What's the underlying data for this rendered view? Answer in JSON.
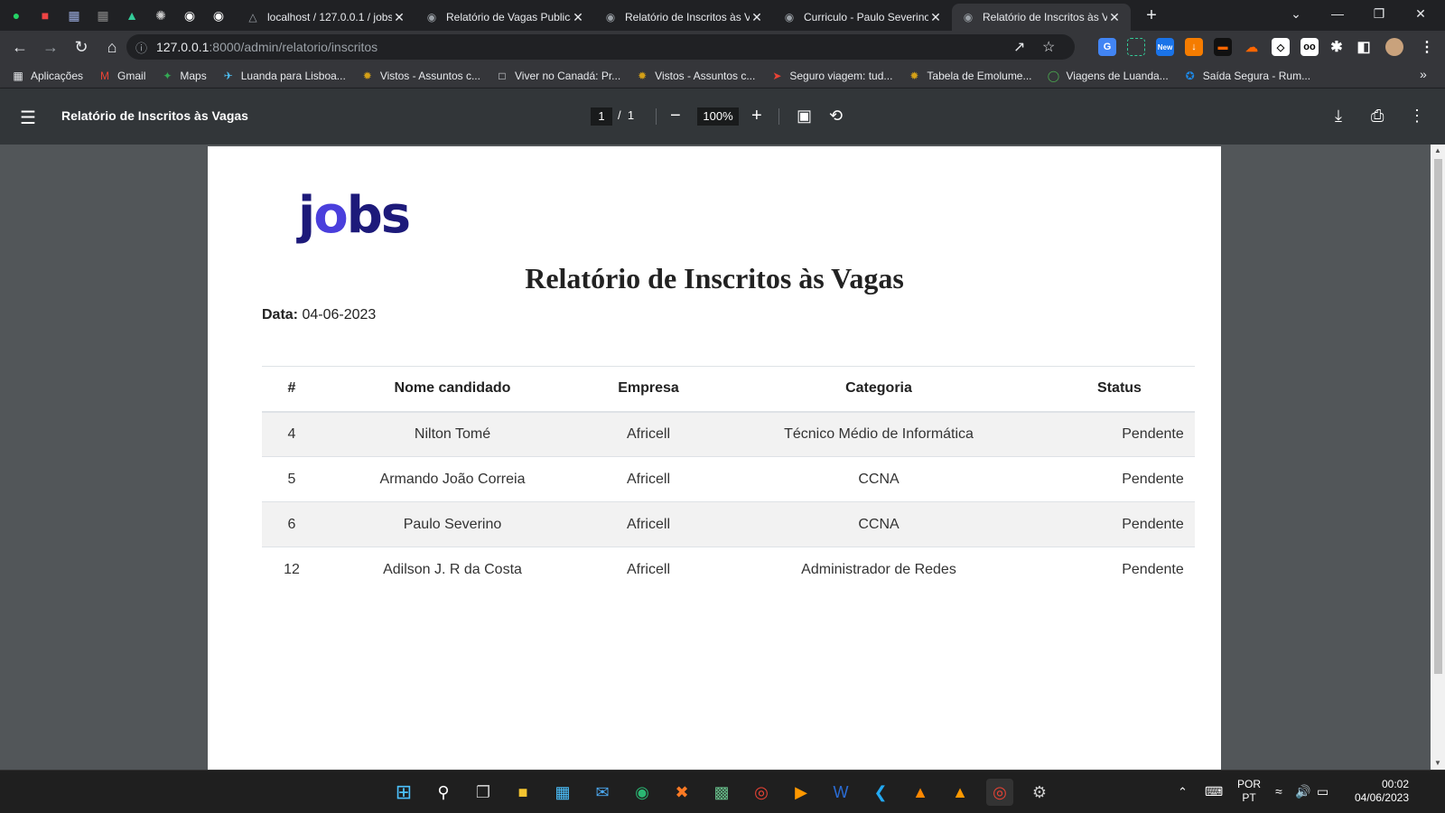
{
  "browser": {
    "tabs": [
      {
        "title": "localhost / 127.0.0.1 / jobs",
        "active": false
      },
      {
        "title": "Relatório de Vagas Publicadas",
        "active": false
      },
      {
        "title": "Relatório de Inscritos às Vagas",
        "active": false
      },
      {
        "title": "Curriculo - Paulo Severino",
        "active": false
      },
      {
        "title": "Relatório de Inscritos às Vagas",
        "active": true
      }
    ],
    "url_host": "127.0.0.1",
    "url_path": ":8000/admin/relatorio/inscritos",
    "bookmarks": [
      {
        "label": "Aplicações",
        "icon": "apps-grid-icon"
      },
      {
        "label": "Gmail",
        "icon": "gmail-icon"
      },
      {
        "label": "Maps",
        "icon": "maps-icon"
      },
      {
        "label": "Luanda para Lisboa...",
        "icon": "flight-icon"
      },
      {
        "label": "Vistos - Assuntos c...",
        "icon": "emblem-icon"
      },
      {
        "label": "Viver no Canadá: Pr...",
        "icon": "page-icon"
      },
      {
        "label": "Vistos - Assuntos c...",
        "icon": "emblem-icon"
      },
      {
        "label": "Seguro viagem: tud...",
        "icon": "plane-icon"
      },
      {
        "label": "Tabela de Emolume...",
        "icon": "emblem-icon"
      },
      {
        "label": "Viagens de Luanda...",
        "icon": "globe-icon"
      },
      {
        "label": "Saída Segura - Rum...",
        "icon": "star-icon"
      }
    ],
    "ext_new_badge": "New"
  },
  "pdf_viewer": {
    "title": "Relatório de Inscritos às Vagas",
    "current_page": "1",
    "page_sep": "/",
    "total_pages": "1",
    "zoom": "100%"
  },
  "report": {
    "logo_text_j": "j",
    "logo_text_o": "o",
    "logo_text_bs": "bs",
    "title": "Relatório de Inscritos às Vagas",
    "date_label": "Data:",
    "date_value": "04-06-2023",
    "columns": [
      "#",
      "Nome candidado",
      "Empresa",
      "Categoria",
      "Status"
    ],
    "rows": [
      [
        "4",
        "Nilton Tomé",
        "Africell",
        "Técnico Médio de Informática",
        "Pendente"
      ],
      [
        "5",
        "Armando João Correia",
        "Africell",
        "CCNA",
        "Pendente"
      ],
      [
        "6",
        "Paulo Severino",
        "Africell",
        "CCNA",
        "Pendente"
      ],
      [
        "12",
        "Adilson J. R da Costa",
        "Africell",
        "Administrador de Redes",
        "Pendente"
      ]
    ]
  },
  "taskbar": {
    "lang_top": "POR",
    "lang_bottom": "PT",
    "time": "00:02",
    "date": "04/06/2023"
  }
}
